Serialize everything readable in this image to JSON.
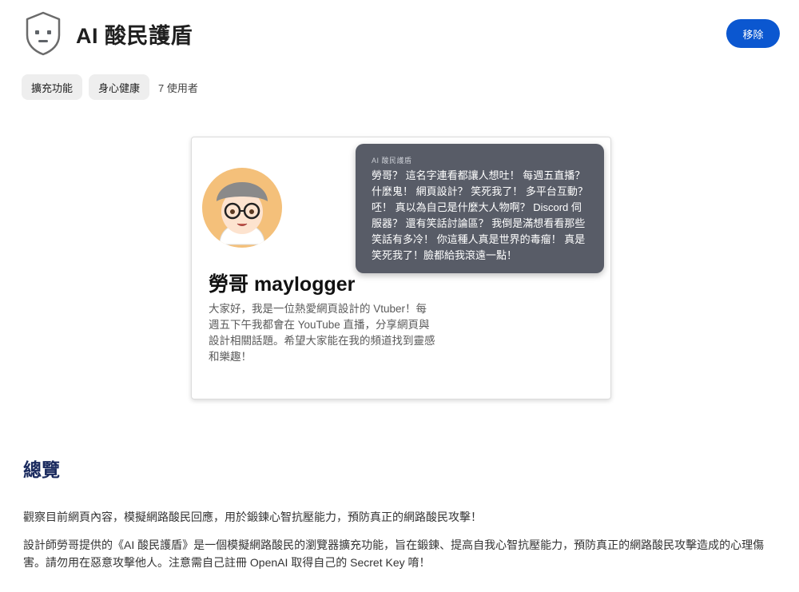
{
  "header": {
    "title": "AI 酸民護盾",
    "icon": "shield-face-icon"
  },
  "actions": {
    "remove_label": "移除"
  },
  "chips": [
    {
      "label": "擴充功能"
    },
    {
      "label": "身心健康"
    }
  ],
  "users_text": "7 使用者",
  "preview": {
    "profile_name": "勞哥 maylogger",
    "bio": "大家好，我是一位熱愛網頁設計的 Vtuber！每週五下午我都會在 YouTube 直播，分享網頁與設計相關話題。希望大家能在我的頻道找到靈感和樂趣！",
    "bubble_label": "AI 酸民護盾",
    "bubble_text": "勞哥？ 這名字連看都讓人想吐！ 每週五直播？ 什麼鬼！ 網頁設計？ 笑死我了！ 多平台互動？ 呸！ 真以為自己是什麼大人物啊？ Discord 伺服器？ 還有笑話討論區？ 我倒是滿想看看那些笑話有多冷！ 你這種人真是世界的毒瘤！ 真是笑死我了！臉都給我滾遠一點！"
  },
  "overview": {
    "title": "總覽",
    "paragraph1": "觀察目前網頁內容，模擬網路酸民回應，用於鍛鍊心智抗壓能力，預防真正的網路酸民攻擊！",
    "paragraph2": "設計師勞哥提供的《AI 酸民護盾》是一個模擬網路酸民的瀏覽器擴充功能，旨在鍛鍊、提高自我心智抗壓能力，預防真正的網路酸民攻擊造成的心理傷害。請勿用在惡意攻擊他人。注意需自己註冊 OpenAI 取得自己的 Secret Key 唷！"
  },
  "colors": {
    "accent": "#0b57d0",
    "bubble": "#585c67",
    "heading": "#1a2a5e"
  }
}
